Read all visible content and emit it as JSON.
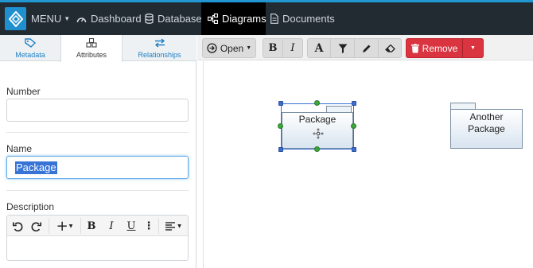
{
  "nav": {
    "menu_label": "MENU",
    "items": [
      {
        "label": "Dashboard",
        "icon": "dashboard-icon"
      },
      {
        "label": "Database",
        "icon": "database-icon"
      },
      {
        "label": "Diagrams",
        "icon": "diagram-icon",
        "active": true
      },
      {
        "label": "Documents",
        "icon": "document-icon"
      }
    ]
  },
  "left_tabs": [
    {
      "label": "Metadata",
      "icon": "tag-icon"
    },
    {
      "label": "Attributes",
      "icon": "cubes-icon",
      "active": true
    },
    {
      "label": "Relationships",
      "icon": "exchange-icon"
    }
  ],
  "fields": {
    "number_label": "Number",
    "number_value": "",
    "name_label": "Name",
    "name_value": "Package",
    "description_label": "Description"
  },
  "toolbar": {
    "open_label": "Open",
    "remove_label": "Remove"
  },
  "canvas": {
    "packages": [
      {
        "label": "Package",
        "selected": true
      },
      {
        "label_line1": "Another",
        "label_line2": "Package",
        "selected": false
      }
    ]
  },
  "colors": {
    "nav_bg": "#222b32",
    "nav_accent": "#2196d3",
    "danger": "#d9343f",
    "selection": "#3873d6"
  }
}
